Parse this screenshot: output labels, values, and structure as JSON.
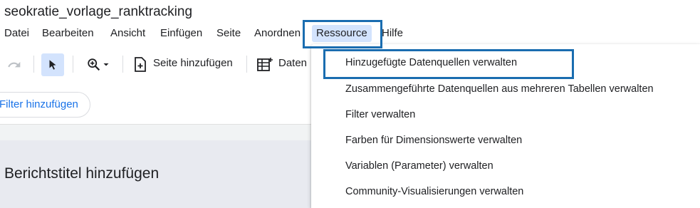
{
  "title": "seokratie_vorlage_ranktracking",
  "menu": [
    "Datei",
    "Bearbeiten",
    "Ansicht",
    "Einfügen",
    "Seite",
    "Anordnen",
    "Ressource",
    "Hilfe"
  ],
  "toolbar": {
    "add_page_label": "Seite hinzufügen",
    "data_label": "Daten"
  },
  "filter": {
    "add_filter_label": "Filter hinzufügen"
  },
  "report": {
    "title_placeholder": "Berichtstitel hinzufügen"
  },
  "dropdown": {
    "items": [
      "Hinzugefügte Datenquellen verwalten",
      "Zusammengeführte Datenquellen aus mehreren Tabellen verwalten",
      "Filter verwalten",
      "Farben für Dimensionswerte verwalten",
      "Variablen (Parameter) verwalten",
      "Community-Visualisierungen verwalten"
    ]
  },
  "colors": {
    "highlight_border": "#1a6db0",
    "active_menu_bg": "#d3e3fd",
    "link_blue": "#1a73e8"
  }
}
